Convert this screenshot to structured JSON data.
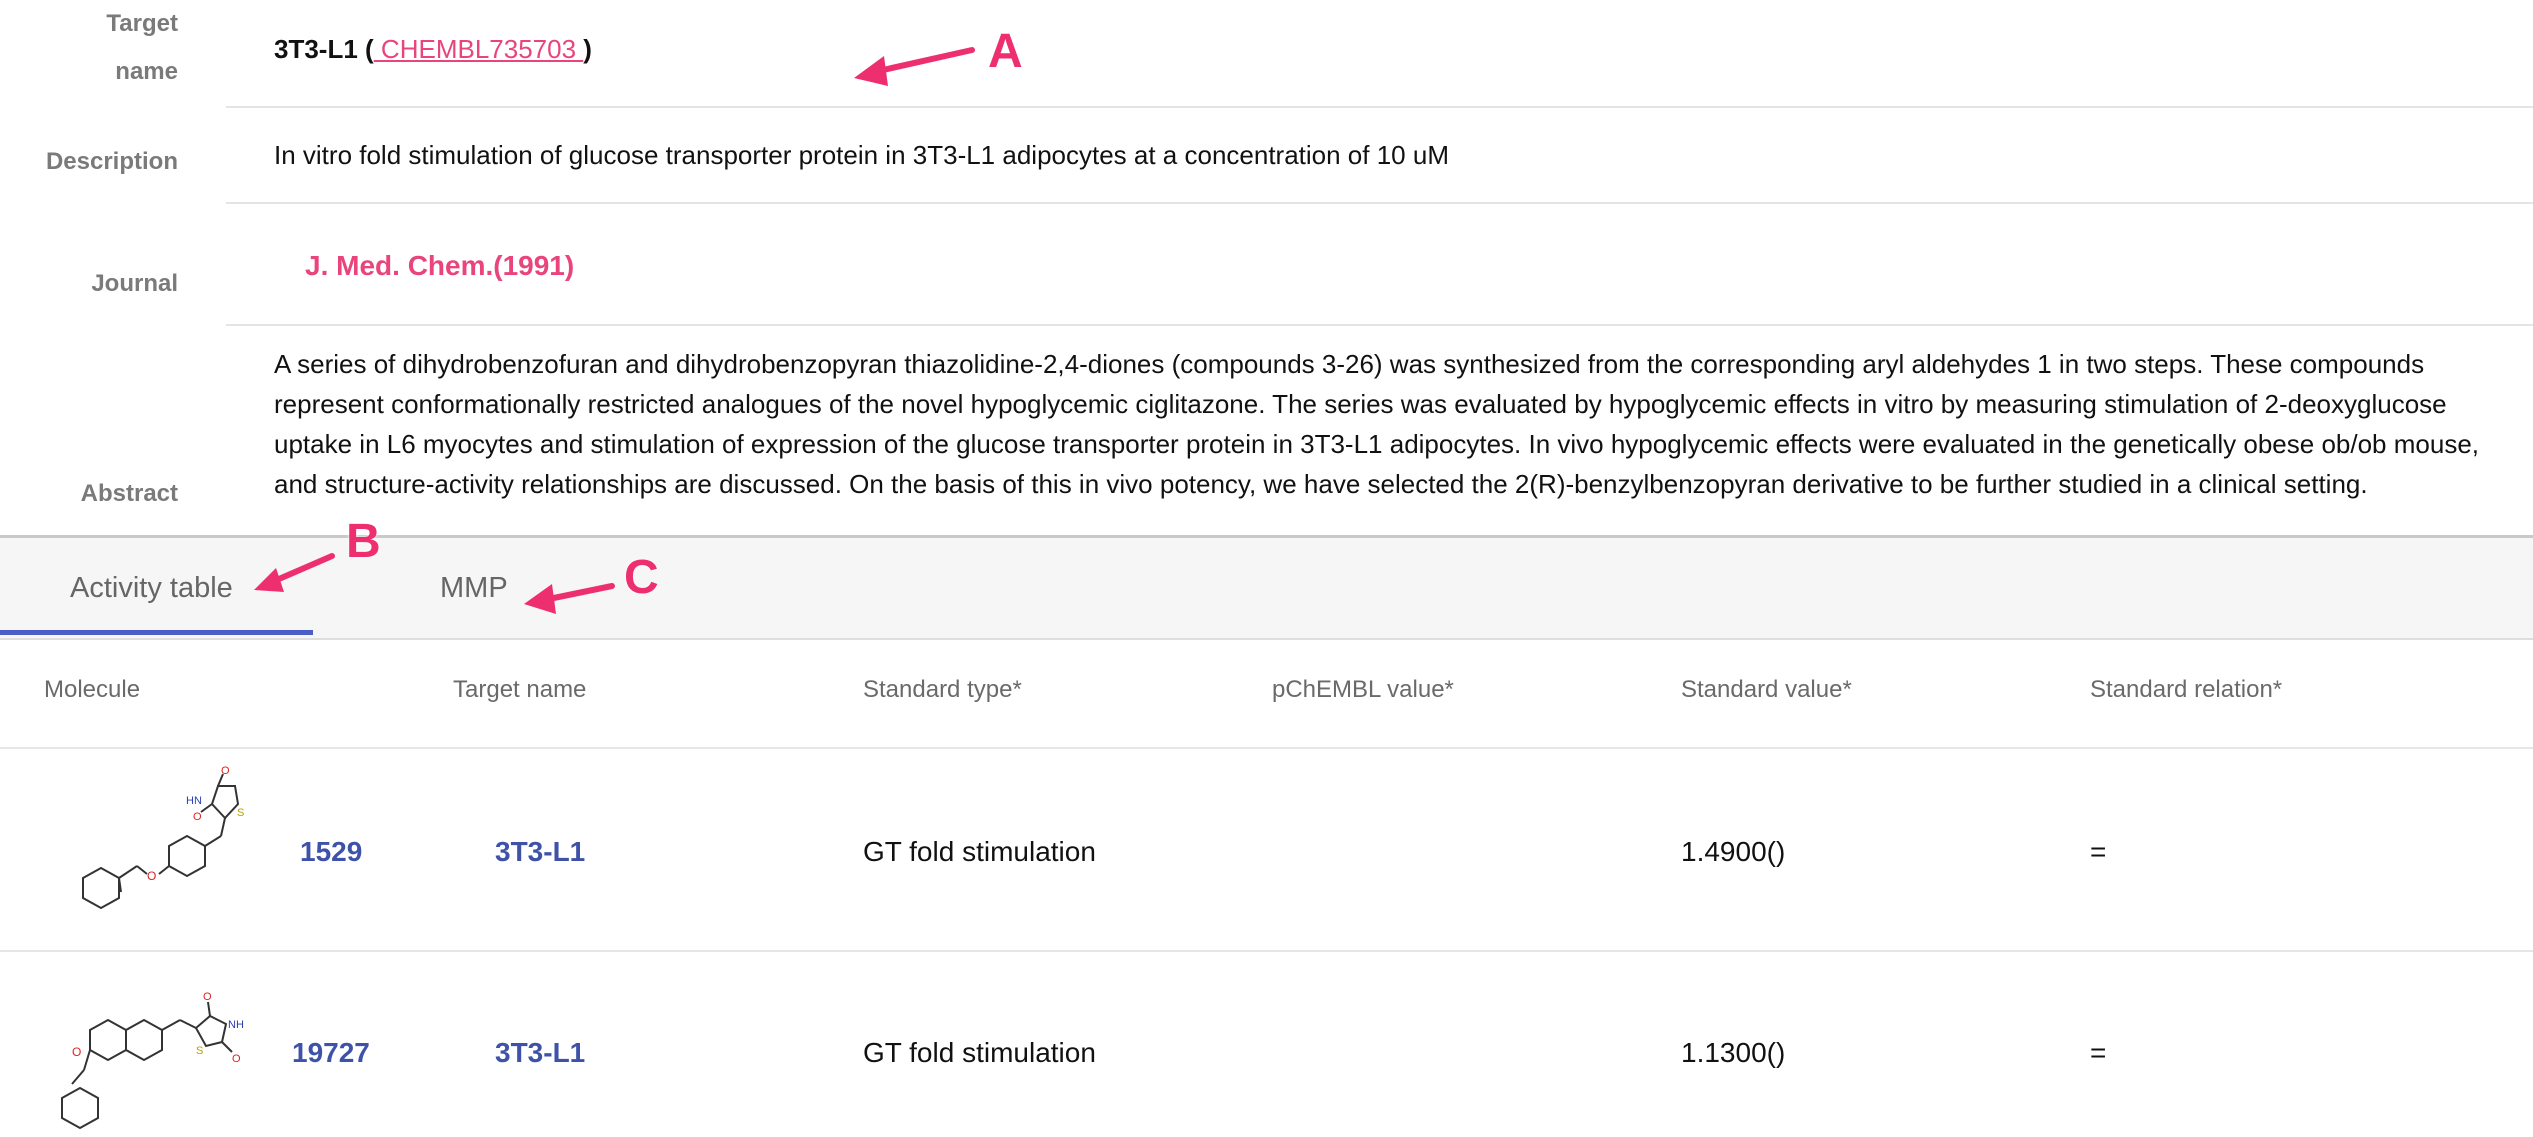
{
  "details": {
    "target_label": "Target name",
    "target_value": "3T3-L1",
    "target_open": " (",
    "target_id": " CHEMBL735703 ",
    "target_close": ")",
    "description_label": "Description",
    "description_value": "In vitro fold stimulation of glucose transporter protein in 3T3-L1 adipocytes at a concentration of 10 uM",
    "journal_label": "Journal",
    "journal_value": "J. Med. Chem.(1991)",
    "abstract_label": "Abstract",
    "abstract_value": "A series of dihydrobenzofuran and dihydrobenzopyran thiazolidine-2,4-diones (compounds 3-26) was synthesized from the corresponding aryl aldehydes 1 in two steps. These compounds represent conformationally restricted analogues of the novel hypoglycemic ciglitazone. The series was evaluated by hypoglycemic effects in vitro by measuring stimulation of 2-deoxyglucose uptake in L6 myocytes and stimulation of expression of the glucose transporter protein in 3T3-L1 adipocytes. In vivo hypoglycemic effects were evaluated in the genetically obese ob/ob mouse, and structure-activity relationships are discussed. On the basis of this in vivo potency, we have selected the 2(R)-benzylbenzopyran derivative to be further studied in a clinical setting."
  },
  "tabs": [
    {
      "label": "Activity table",
      "active": true
    },
    {
      "label": "MMP",
      "active": false
    }
  ],
  "table": {
    "headers": [
      "Molecule",
      "Target name",
      "Standard type*",
      "pChEMBL value*",
      "Standard value*",
      "Standard relation*"
    ],
    "rows": [
      {
        "molecule_id": "1529",
        "target": "3T3-L1",
        "standard_type": "GT fold stimulation",
        "pchembl": "",
        "standard_value": "1.4900()",
        "relation": "="
      },
      {
        "molecule_id": "19727",
        "target": "3T3-L1",
        "standard_type": "GT fold stimulation",
        "pchembl": "",
        "standard_value": "1.1300()",
        "relation": "="
      }
    ]
  },
  "annotations": {
    "a": "A",
    "b": "B",
    "c": "C"
  },
  "colors": {
    "accent_pink": "#e9457c",
    "link_blue": "#3d52a8",
    "tab_underline": "#4a5ec6",
    "annotation": "#ee2f6f"
  }
}
